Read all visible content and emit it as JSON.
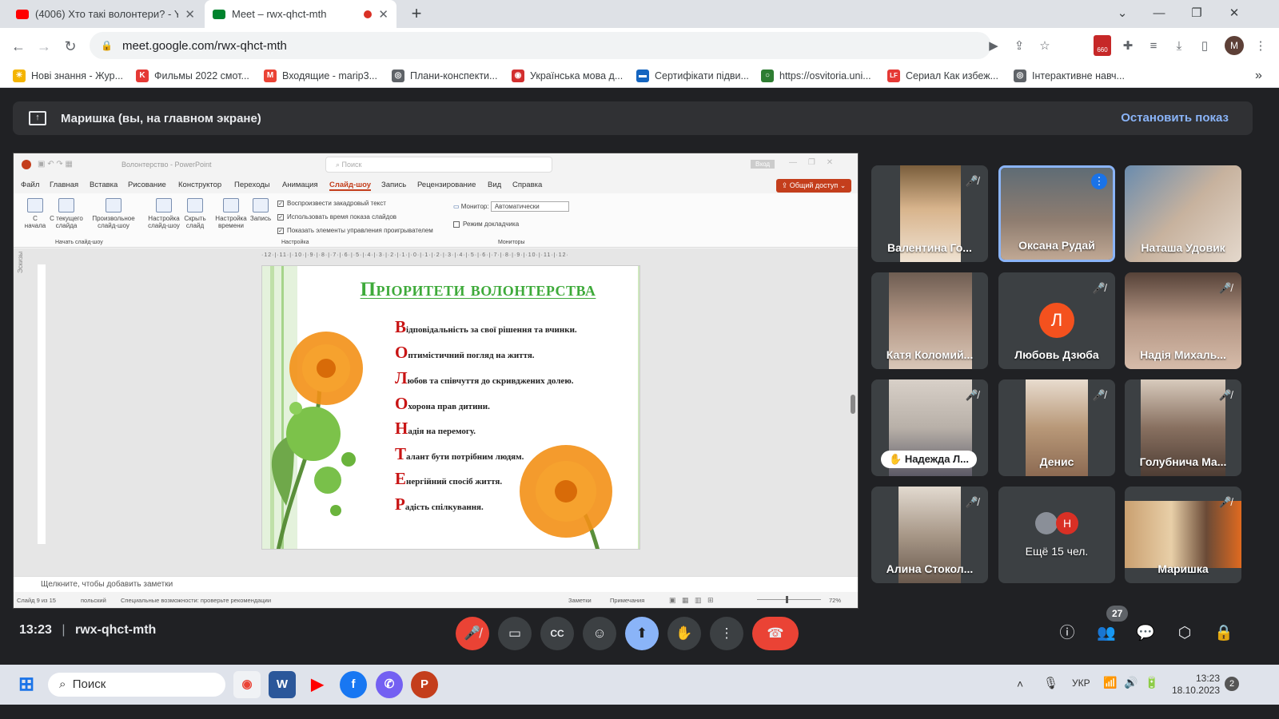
{
  "browser": {
    "tabs": [
      {
        "title": "(4006) Хто такі волонтери? - Yo",
        "fav_color": "#ff0000"
      },
      {
        "title": "Meet – rwx-qhct-mth",
        "fav_color": "#00832d",
        "recording_dot": "#d93025"
      }
    ],
    "new_tab": "+",
    "url": "meet.google.com/rwx-qhct-mth",
    "extension_badge": "660",
    "profile": "M",
    "bookmarks": [
      {
        "label": "Нові знання - Жур...",
        "color": "#f4b400",
        "glyph": "☀"
      },
      {
        "label": "Фильмы 2022 смот...",
        "color": "#e53935",
        "glyph": "K"
      },
      {
        "label": "Входящие - marip3...",
        "color": "#ea4335",
        "glyph": "M"
      },
      {
        "label": "Плани-конспекти...",
        "color": "#5f6368",
        "glyph": "◎"
      },
      {
        "label": "Українська мова д...",
        "color": "#d32f2f",
        "glyph": "◉"
      },
      {
        "label": "Сертифікати підви...",
        "color": "#1565c0",
        "glyph": "▬"
      },
      {
        "label": "https://osvitoria.uni...",
        "color": "#2e7d32",
        "glyph": "○"
      },
      {
        "label": "Сериал Как избеж...",
        "color": "#e53935",
        "glyph": "LF"
      },
      {
        "label": "Інтерактивне навч...",
        "color": "#5f6368",
        "glyph": "◎"
      }
    ],
    "bookmarks_more": "»"
  },
  "meet": {
    "presenting_label": "Маришка (вы, на главном экране)",
    "stop_presenting": "Остановить показ",
    "time": "13:23",
    "separator": "|",
    "meeting_code": "rwx-qhct-mth",
    "participants_count": "27",
    "accent": "#8ab4f8",
    "end_call_color": "#ea4335",
    "participants": [
      {
        "name": "Валентина Го...",
        "muted": true,
        "avatar_color": "#caa07a"
      },
      {
        "name": "Оксана Рудай",
        "muted": false,
        "speaking": true,
        "avatar_color": "#6b7a8a"
      },
      {
        "name": "Наташа Удовик",
        "muted": false,
        "avatar_color": "#9ab0c8"
      },
      {
        "name": "Катя Коломий...",
        "muted": false,
        "avatar_color": "#8a7466"
      },
      {
        "name": "Любовь Дзюба",
        "muted": true,
        "initial": "Л",
        "initial_color": "#f4511e"
      },
      {
        "name": "Надія Михаль...",
        "muted": true,
        "avatar_color": "#a08070"
      },
      {
        "name": "Надежда Л...",
        "muted": true,
        "hand_raised": true,
        "avatar_color": "#b8b0a8"
      },
      {
        "name": "Денис",
        "muted": true,
        "avatar_color": "#b89878"
      },
      {
        "name": "Голубнича Ма...",
        "muted": true,
        "avatar_color": "#887060"
      },
      {
        "name": "Алина Стокол...",
        "muted": true,
        "avatar_color": "#a89888"
      },
      {
        "name": "Ещё 15 чел.",
        "muted": false,
        "initial": "Н",
        "initial_color": "#d93025"
      },
      {
        "name": "Маришка",
        "muted": true,
        "avatar_color": "#c8a070"
      }
    ]
  },
  "ppt": {
    "title": "Волонтерство - PowerPoint",
    "search": "Поиск",
    "sign_in": "Вход",
    "menu": [
      "Файл",
      "Главная",
      "Вставка",
      "Рисование",
      "Конструктор",
      "Переходы",
      "Анимация",
      "Слайд-шоу",
      "Запись",
      "Рецензирование",
      "Вид",
      "Справка"
    ],
    "active_menu": "Слайд-шоу",
    "share": "Общий доступ",
    "ribbon": {
      "from_start": "С начала",
      "from_current": "С текущего слайда",
      "custom": "Произвольное слайд-шоу",
      "setup": "Настройка слайд-шоу",
      "hide": "Скрыть слайд",
      "rehearse": "Настройка времени",
      "record": "Запись",
      "chk1": "Воспроизвести закадровый текст",
      "chk2": "Использовать время показа слайдов",
      "chk3": "Показать элементы управления проигрывателем",
      "monitor_label": "Монитор:",
      "monitor_value": "Автоматически",
      "presenter_view": "Режим докладчика",
      "group1": "Начать слайд-шоу",
      "group2": "Настройка",
      "group3": "Мониторы"
    },
    "thumbs_label": "Эскизы",
    "slide": {
      "title": "Пріоритети волонтерства",
      "lines": [
        {
          "cap": "В",
          "rest": "ідповідальність за свої рішення та вчинки."
        },
        {
          "cap": "О",
          "rest": "птимістичний погляд на життя."
        },
        {
          "cap": "Л",
          "rest": "юбов та співчуття до скривджених долею."
        },
        {
          "cap": "О",
          "rest": "хорона прав дитини."
        },
        {
          "cap": "Н",
          "rest": "адія на перемогу."
        },
        {
          "cap": "Т",
          "rest": "алант бути потрібним людям."
        },
        {
          "cap": "Е",
          "rest": "нергійний спосіб життя."
        },
        {
          "cap": "Р",
          "rest": "адість спілкування."
        }
      ]
    },
    "notes_placeholder": "Щелкните, чтобы добавить заметки",
    "status": {
      "slide": "Слайд 9 из 15",
      "lang": "польский",
      "a11y": "Специальные возможности: проверьте рекомендации",
      "notes": "Заметки",
      "comments": "Примечания",
      "zoom": "72%"
    }
  },
  "taskbar": {
    "search": "Поиск",
    "lang": "УКР",
    "time": "13:23",
    "date": "18.10.2023",
    "notifications": "2"
  }
}
